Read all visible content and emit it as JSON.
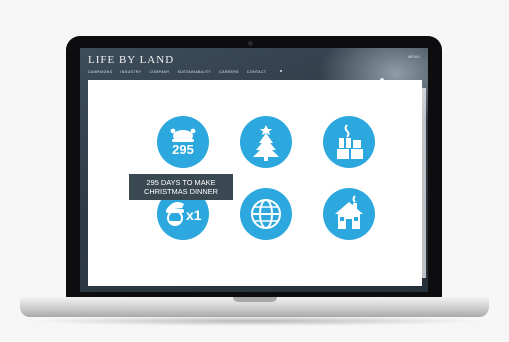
{
  "site": {
    "logo": "LIFE BY LAND",
    "nav": [
      "CAMPAIGNS",
      "INDUSTRY",
      "COMPANY",
      "SUSTAINABILITY",
      "CAREERS",
      "CONTACT"
    ],
    "topright": "MENU"
  },
  "icons": [
    {
      "name": "turkey-icon",
      "count": "295"
    },
    {
      "name": "christmas-tree-icon"
    },
    {
      "name": "presents-icon"
    },
    {
      "name": "santa-icon",
      "multiplier": "x1"
    },
    {
      "name": "globe-icon"
    },
    {
      "name": "cabin-icon"
    }
  ],
  "tooltip": {
    "line1": "295 DAYS TO MAKE",
    "line2": "CHRISTMAS DINNER"
  },
  "colors": {
    "accent": "#2ca8de",
    "tooltip_bg": "#3a4852"
  }
}
